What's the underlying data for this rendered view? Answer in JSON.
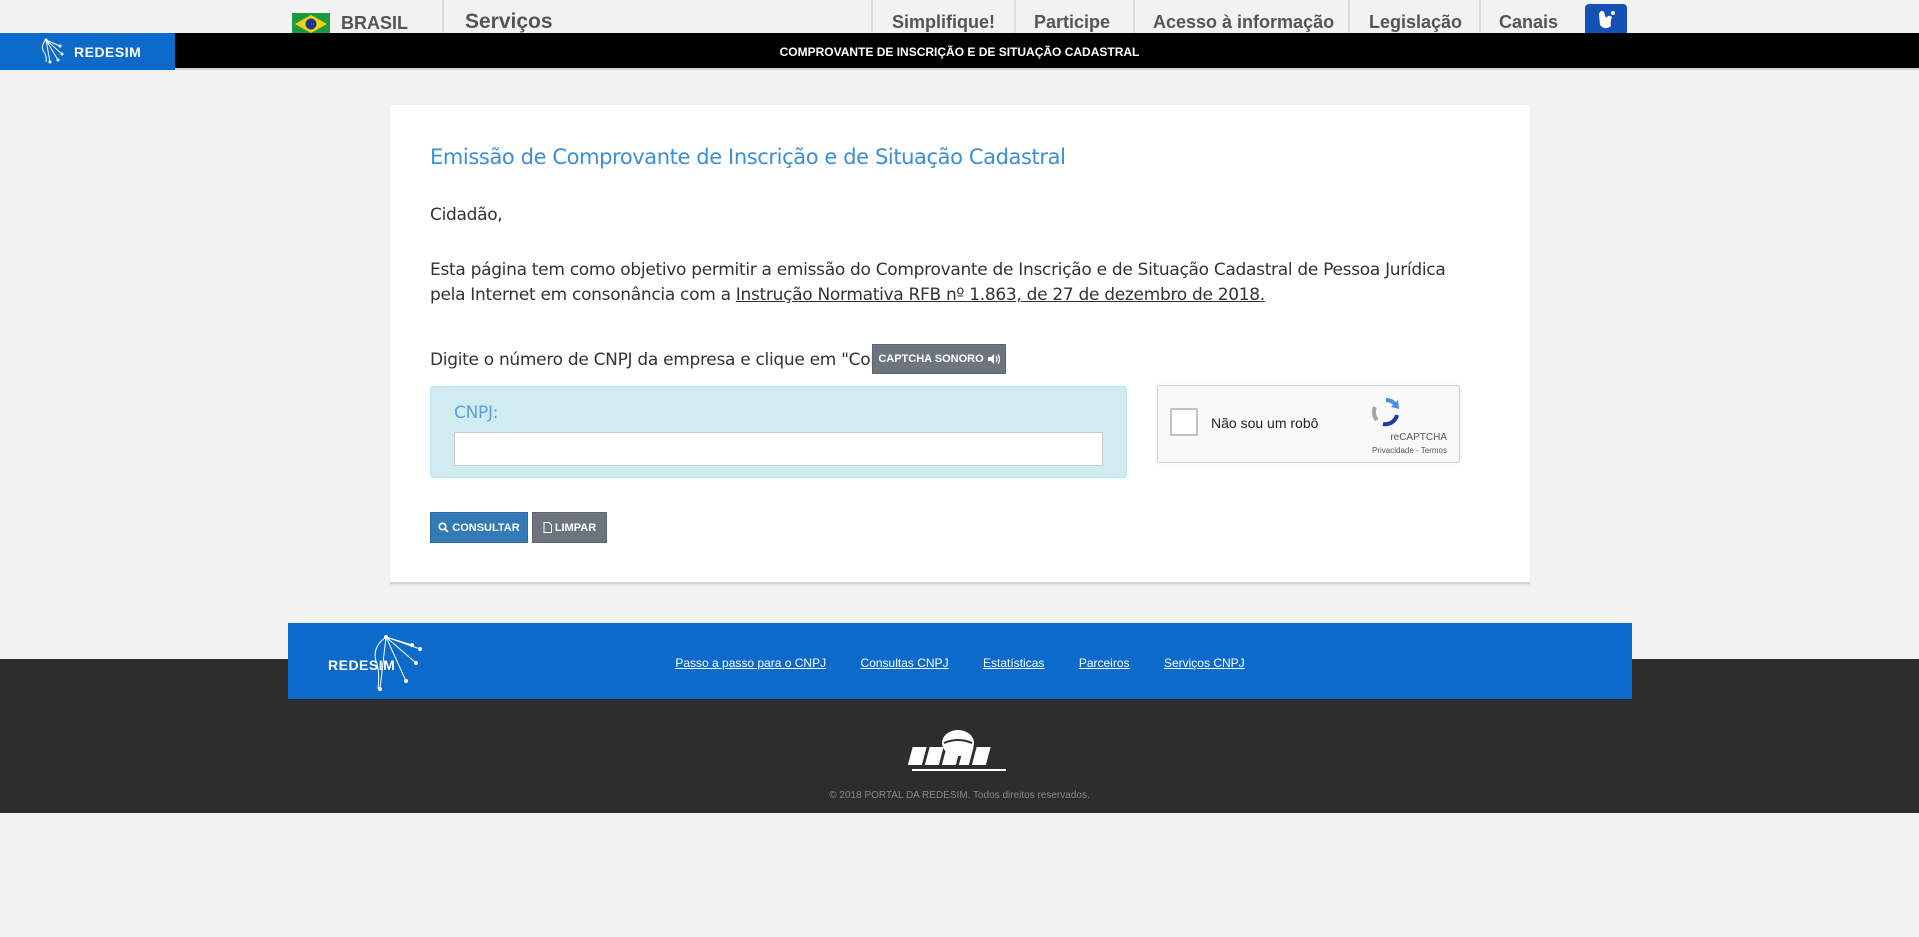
{
  "govbar": {
    "country": "BRASIL",
    "services": "Serviços",
    "nav": [
      "Simplifique!",
      "Participe",
      "Acesso à informação",
      "Legislação",
      "Canais"
    ]
  },
  "header": {
    "logo_text": "REDESIM",
    "title": "COMPROVANTE DE INSCRIÇÃO E DE SITUAÇÃO CADASTRAL"
  },
  "main": {
    "title": "Emissão de Comprovante de Inscrição e de Situação Cadastral",
    "greeting": "Cidadão,",
    "intro_prefix": "Esta página tem como objetivo permitir a emissão do Comprovante de Inscrição e de Situação Cadastral de Pessoa Jurídica pela Internet em consonância com a ",
    "intro_link": "Instrução Normativa RFB nº 1.863, de 27 de dezembro de 2018.",
    "instruction": "Digite o número de CNPJ da empresa e clique em \"Consultar\".",
    "captcha_audio_label": "CAPTCHA SONORO",
    "cnpj_label": "CNPJ:",
    "cnpj_value": "",
    "consult_label": "CONSULTAR",
    "clear_label": "LIMPAR"
  },
  "recaptcha": {
    "label": "Não sou um robô",
    "brand": "reCAPTCHA",
    "privacy": "Privacidade",
    "terms": "Termos"
  },
  "footer": {
    "logo_text": "REDESIM",
    "links": [
      "Passo a passo para o CNPJ",
      "Consultas CNPJ",
      "Estatísticas",
      "Parceiros",
      "Serviços CNPJ"
    ],
    "copyright": "2018 PORTAL DA REDESIM. Todos direitos reservados."
  },
  "colors": {
    "brand_blue": "#0c6acb",
    "title_blue": "#3a8fd8",
    "info_box": "#d1ecf1",
    "primary_button": "#337ab7",
    "secondary_button": "#6c757d",
    "footer_dark": "#2d2d2d"
  }
}
